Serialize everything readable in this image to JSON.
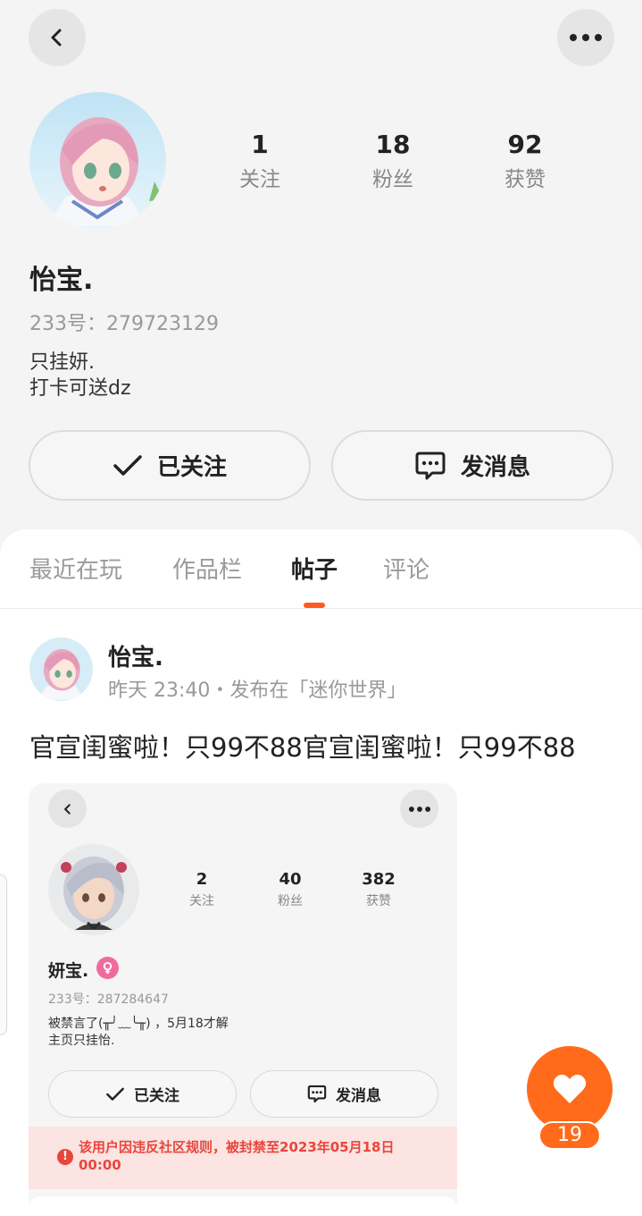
{
  "profile": {
    "name": "怡宝.",
    "uid": "233号：279723129",
    "bio": [
      "只挂妍.",
      "打卡可送dz"
    ],
    "stats": [
      {
        "num": "1",
        "label": "关注"
      },
      {
        "num": "18",
        "label": "粉丝"
      },
      {
        "num": "92",
        "label": "获赞"
      }
    ],
    "follow_label": "已关注",
    "message_label": "发消息"
  },
  "tabs": {
    "items": [
      "最近在玩",
      "作品栏",
      "帖子",
      "评论"
    ],
    "active": "帖子"
  },
  "post": {
    "author": "怡宝.",
    "meta": "昨天 23:40・发布在「迷你世界」",
    "text": "官宣闺蜜啦！只99不88官宣闺蜜啦！只99不88",
    "likes": "19"
  },
  "embedded_profile": {
    "name": "妍宝.",
    "uid": "233号：287284647",
    "bio": [
      "被禁言了(╥╯﹏╰╥) ，5月18才解",
      "主页只挂怡."
    ],
    "stats": [
      {
        "num": "2",
        "label": "关注"
      },
      {
        "num": "40",
        "label": "粉丝"
      },
      {
        "num": "382",
        "label": "获赞"
      }
    ],
    "follow_label": "已关注",
    "message_label": "发消息",
    "ban_notice": "该用户因违反社区规则，被封禁至2023年05月18日 00:00"
  },
  "colors": {
    "accent": "#ff6b1a",
    "tab_indicator": "#ff5a1f",
    "ban_text": "#e8463d",
    "ban_bg": "#fbe4e2",
    "gender_female": "#f06b9c"
  },
  "icons": [
    "back-icon",
    "more-icon",
    "check-icon",
    "chat-icon",
    "heart-icon",
    "female-icon",
    "alert-icon"
  ]
}
